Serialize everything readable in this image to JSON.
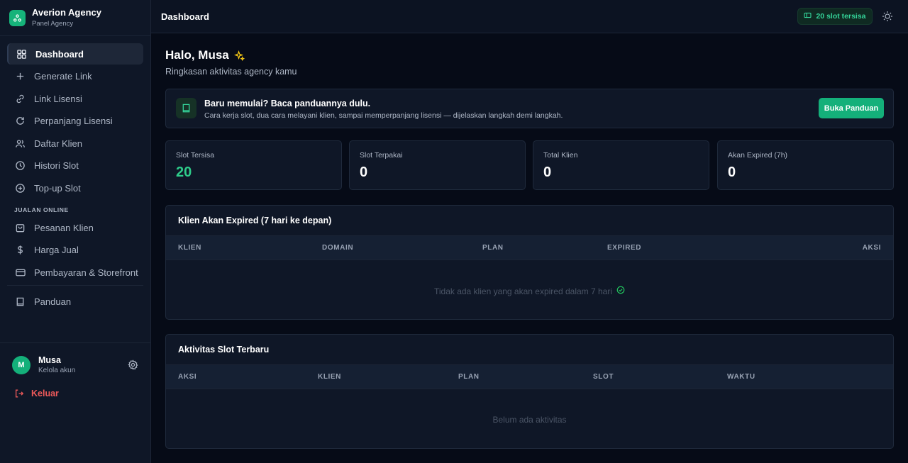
{
  "brand": {
    "name": "Averion Agency",
    "subtitle": "Panel Agency"
  },
  "sidebar": {
    "items": [
      {
        "label": "Dashboard",
        "icon": "grid-icon",
        "active": true
      },
      {
        "label": "Generate Link",
        "icon": "plus-icon"
      },
      {
        "label": "Link Lisensi",
        "icon": "link-icon"
      },
      {
        "label": "Perpanjang Lisensi",
        "icon": "refresh-icon"
      },
      {
        "label": "Daftar Klien",
        "icon": "users-icon"
      },
      {
        "label": "Histori Slot",
        "icon": "clock-icon"
      },
      {
        "label": "Top-up Slot",
        "icon": "plus-circle-icon"
      }
    ],
    "section_label": "JUALAN ONLINE",
    "section_items": [
      {
        "label": "Pesanan Klien",
        "icon": "shopping-bag-icon"
      },
      {
        "label": "Harga Jual",
        "icon": "dollar-icon"
      },
      {
        "label": "Pembayaran & Storefront",
        "icon": "credit-card-icon"
      }
    ],
    "guide_item": {
      "label": "Panduan",
      "icon": "book-icon"
    }
  },
  "user": {
    "initial": "M",
    "name": "Musa",
    "subtitle": "Kelola akun",
    "logout_label": "Keluar"
  },
  "topbar": {
    "title": "Dashboard",
    "slot_badge": "20 slot tersisa"
  },
  "greeting": {
    "title": "Halo, Musa",
    "subtitle": "Ringkasan aktivitas agency kamu"
  },
  "guide_banner": {
    "title": "Baru memulai? Baca panduannya dulu.",
    "description": "Cara kerja slot, dua cara melayani klien, sampai memperpanjang lisensi — dijelaskan langkah demi langkah.",
    "button": "Buka Panduan"
  },
  "stats": [
    {
      "label": "Slot Tersisa",
      "value": "20"
    },
    {
      "label": "Slot Terpakai",
      "value": "0"
    },
    {
      "label": "Total Klien",
      "value": "0"
    },
    {
      "label": "Akan Expired (7h)",
      "value": "0"
    }
  ],
  "expiring_table": {
    "title": "Klien Akan Expired (7 hari ke depan)",
    "columns": [
      "KLIEN",
      "DOMAIN",
      "PLAN",
      "EXPIRED",
      "AKSI"
    ],
    "empty_text": "Tidak ada klien yang akan expired dalam 7 hari"
  },
  "activity_table": {
    "title": "Aktivitas Slot Terbaru",
    "columns": [
      "AKSI",
      "KLIEN",
      "PLAN",
      "SLOT",
      "WAKTU"
    ],
    "empty_text": "Belum ada aktivitas"
  },
  "colors": {
    "accent": "#14b07a",
    "accent_text": "#34d399",
    "danger": "#ef5a5a",
    "background": "#060b17",
    "surface": "#0f1727"
  }
}
